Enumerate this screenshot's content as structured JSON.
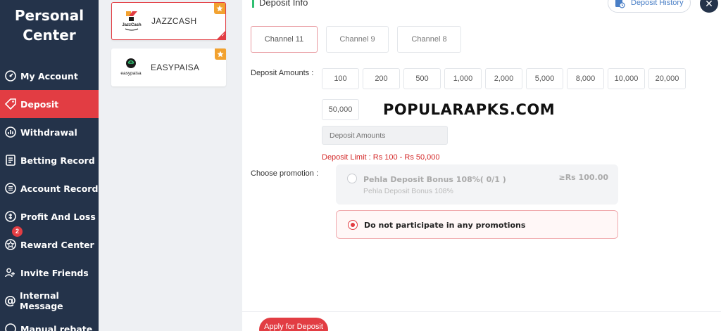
{
  "sidebar": {
    "title_line1": "Personal",
    "title_line2": "Center",
    "items": [
      {
        "label": "My Account",
        "icon": "gauge-icon"
      },
      {
        "label": "Deposit",
        "icon": "tag-icon",
        "active": true
      },
      {
        "label": "Withdrawal",
        "icon": "chart-icon"
      },
      {
        "label": "Betting Record",
        "icon": "document-icon"
      },
      {
        "label": "Account Record",
        "icon": "list-icon"
      },
      {
        "label": "Profit And Loss",
        "icon": "profit-icon"
      },
      {
        "label": "Reward Center",
        "icon": "star-icon",
        "badge": "2"
      },
      {
        "label": "Invite Friends",
        "icon": "users-icon"
      },
      {
        "label": "Internal Message",
        "icon": "at-icon"
      },
      {
        "label": "Manual rebate",
        "icon": "rebate-icon"
      }
    ]
  },
  "payments": [
    {
      "label": "JAZZCASH",
      "selected": true
    },
    {
      "label": "EASYPAISA",
      "selected": false
    }
  ],
  "logos": {
    "jazzcash_small": "JazzCash",
    "easypaisa_small": "easypaisa"
  },
  "header": {
    "title": "Deposit Info",
    "history_label": "Deposit History",
    "close_glyph": "✕"
  },
  "channels": [
    {
      "label": "Channel 11",
      "active": true
    },
    {
      "label": "Channel 9",
      "active": false
    },
    {
      "label": "Channel 8",
      "active": false
    }
  ],
  "deposit": {
    "amounts_label": "Deposit Amounts :",
    "amounts": [
      "100",
      "200",
      "500",
      "1,000",
      "2,000",
      "5,000",
      "8,000",
      "10,000",
      "20,000",
      "50,000"
    ],
    "input_placeholder": "Deposit Amounts",
    "limit_text": "Deposit Limit :  Rs  100  - Rs  50,000"
  },
  "watermark": "POPULARAPKS.COM",
  "promotion": {
    "label": "Choose promotion :",
    "bonus_name": "Pehla Deposit Bonus 108%( 0/1 )",
    "bonus_sub": "Pehla Deposit Bonus 108%",
    "bonus_min": "≥Rs  100.00",
    "none_label": "Do not participate in any promotions"
  },
  "apply_label": "Apply for Deposit",
  "colors": {
    "sidebar_bg": "#24334a",
    "accent_red": "#e23d43",
    "link_blue": "#4a7fc6",
    "green_bar": "#2fbf71",
    "hot_orange": "#f2a230"
  }
}
